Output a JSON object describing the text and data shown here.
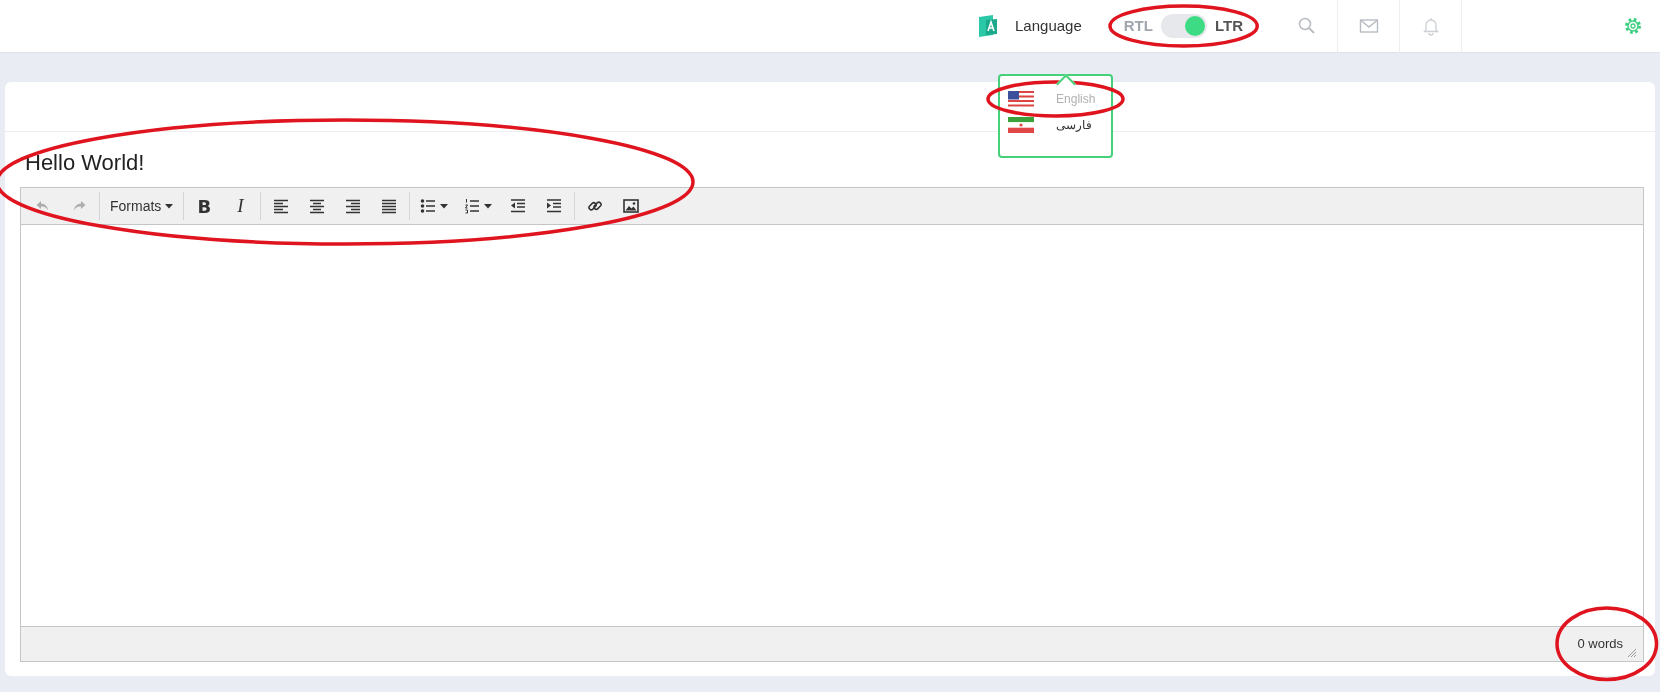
{
  "header": {
    "language_label": "Language",
    "direction": {
      "left_label": "RTL",
      "right_label": "LTR",
      "on": true,
      "circled": true
    }
  },
  "language_menu": {
    "open": true,
    "items": [
      {
        "label": "English",
        "selected": true,
        "circled": true
      },
      {
        "label": "فارسی",
        "selected": false,
        "circled": false
      }
    ]
  },
  "editor": {
    "title": "Hello World!",
    "title_circled": true,
    "toolbar": [
      {
        "kind": "undo",
        "disabled": true
      },
      {
        "kind": "redo",
        "disabled": true
      },
      {
        "kind": "separator"
      },
      {
        "kind": "menu",
        "label": "Formats",
        "disabled": false
      },
      {
        "kind": "separator"
      },
      {
        "kind": "bold",
        "label": "B",
        "disabled": false
      },
      {
        "kind": "italic",
        "label": "I",
        "disabled": false
      },
      {
        "kind": "separator"
      },
      {
        "kind": "alignleft",
        "disabled": false
      },
      {
        "kind": "aligncenter",
        "disabled": false
      },
      {
        "kind": "alignright",
        "disabled": false
      },
      {
        "kind": "alignjustify",
        "disabled": false
      },
      {
        "kind": "separator"
      },
      {
        "kind": "bullets",
        "disabled": false
      },
      {
        "kind": "numbers",
        "disabled": false
      },
      {
        "kind": "outdent",
        "disabled": false
      },
      {
        "kind": "indent",
        "disabled": false
      },
      {
        "kind": "separator"
      },
      {
        "kind": "link",
        "disabled": false
      },
      {
        "kind": "image",
        "disabled": false
      }
    ],
    "word_count": "0 words",
    "word_count_circled": true
  }
}
